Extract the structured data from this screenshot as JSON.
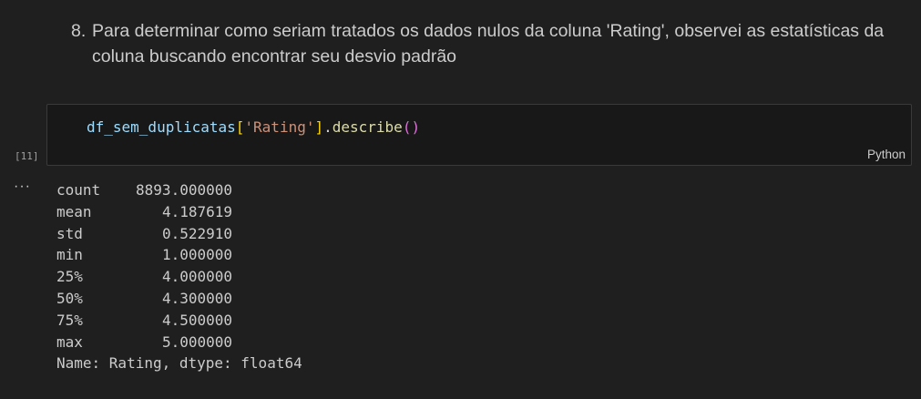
{
  "markdown": {
    "number": "8.",
    "text": "Para determinar como seriam tratados os dados nulos da coluna 'Rating', observei as estatísticas da coluna buscando encontrar seu desvio padrão"
  },
  "code_cell": {
    "tokens": {
      "var": "df_sem_duplicatas",
      "open_bracket": "[",
      "string": "'Rating'",
      "close_bracket": "]",
      "dot": ".",
      "method": "describe",
      "parens": "()"
    },
    "execution_count": "[11]",
    "language": "Python"
  },
  "output": {
    "more_icon": "···",
    "rows": [
      {
        "key": "count",
        "value": "8893.000000"
      },
      {
        "key": "mean",
        "value": "4.187619"
      },
      {
        "key": "std",
        "value": "0.522910"
      },
      {
        "key": "min",
        "value": "1.000000"
      },
      {
        "key": "25%",
        "value": "4.000000"
      },
      {
        "key": "50%",
        "value": "4.300000"
      },
      {
        "key": "75%",
        "value": "4.500000"
      },
      {
        "key": "max",
        "value": "5.000000"
      }
    ],
    "footer": "Name: Rating, dtype: float64"
  },
  "colors": {
    "background": "#1f1f1f",
    "cell_background": "#181818",
    "variable": "#9cdcfe",
    "string": "#ce9178",
    "function": "#dcdcaa",
    "bracket": "#ffd700",
    "paren": "#da70d6"
  }
}
